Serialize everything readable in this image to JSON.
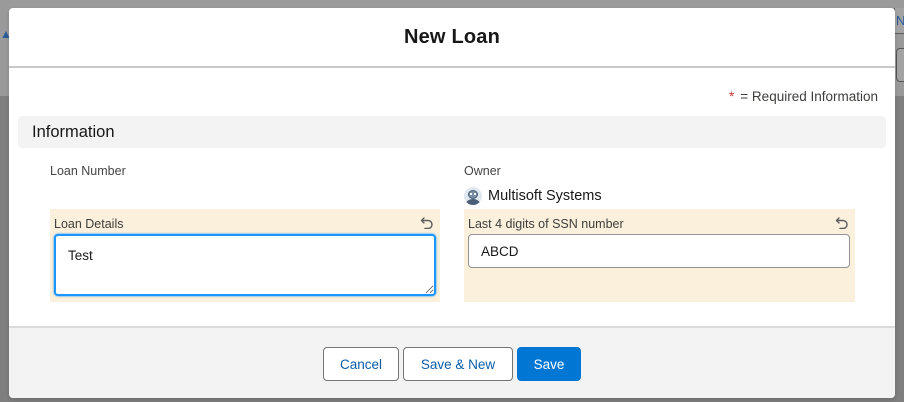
{
  "background": {
    "tab_fragment": "N"
  },
  "modal": {
    "title": "New Loan",
    "required_note": {
      "star": "*",
      "text": "= Required Information"
    },
    "section": {
      "title": "Information"
    },
    "fields": {
      "loan_number": {
        "label": "Loan Number"
      },
      "owner": {
        "label": "Owner",
        "value": "Multisoft Systems",
        "icon": "user-avatar-icon"
      },
      "loan_details": {
        "label": "Loan Details",
        "value": "Test",
        "icon": "undo-icon"
      },
      "ssn_last4": {
        "label": "Last 4 digits of SSN number",
        "value": "ABCD",
        "icon": "undo-icon"
      }
    },
    "footer": {
      "cancel_label": "Cancel",
      "save_new_label": "Save & New",
      "save_label": "Save"
    }
  },
  "colors": {
    "brand_blue": "#0176d3",
    "link_blue": "#0b5cab",
    "edited_field_bg": "#faf0dc",
    "focus_border": "#1b96ff",
    "required_star": "#c23934"
  }
}
